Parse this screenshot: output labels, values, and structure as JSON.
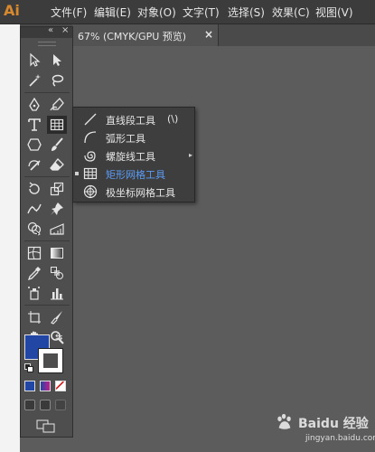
{
  "app": {
    "logo": "Ai"
  },
  "menu": [
    {
      "label": "文件(F)"
    },
    {
      "label": "编辑(E)"
    },
    {
      "label": "对象(O)"
    },
    {
      "label": "文字(T)"
    },
    {
      "label": "选择(S)"
    },
    {
      "label": "效果(C)"
    },
    {
      "label": "视图(V)"
    }
  ],
  "document_tab": {
    "label": "67% (CMYK/GPU 预览)",
    "close": "×"
  },
  "toolbox": {
    "collapse": "«",
    "close": "×"
  },
  "colors": {
    "fill": "#2146a3",
    "stroke": "#ffffff",
    "accent": "#5b9bf4"
  },
  "flyout": {
    "items": [
      {
        "label": "直线段工具",
        "shortcut": "(\\)",
        "icon": "line-segment-icon"
      },
      {
        "label": "弧形工具",
        "shortcut": "",
        "icon": "arc-icon"
      },
      {
        "label": "螺旋线工具",
        "shortcut": "",
        "icon": "spiral-icon"
      },
      {
        "label": "矩形网格工具",
        "shortcut": "",
        "icon": "rectangular-grid-icon",
        "selected": true
      },
      {
        "label": "极坐标网格工具",
        "shortcut": "",
        "icon": "polar-grid-icon"
      }
    ]
  },
  "watermark": {
    "text": "Baidu 经验",
    "url": "jingyan.baidu.com"
  }
}
